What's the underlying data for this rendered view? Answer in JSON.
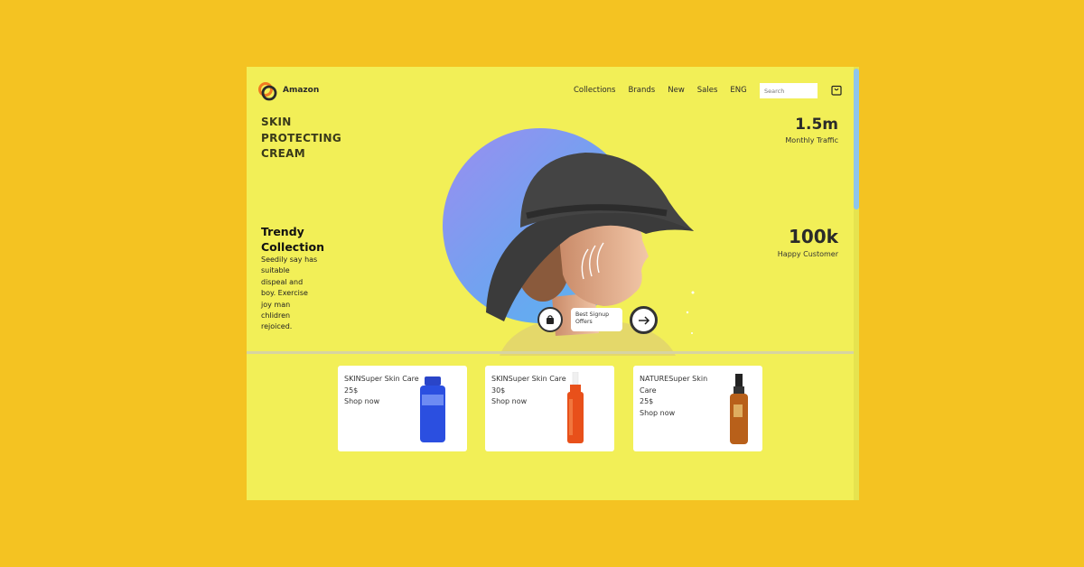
{
  "header": {
    "brand": "Amazon",
    "nav": [
      "Collections",
      "Brands",
      "New",
      "Sales",
      "ENG"
    ],
    "search_placeholder": "Search"
  },
  "hero": {
    "title_lines": [
      "SKIN",
      "PROTECTING",
      "CREAM"
    ],
    "trendy_title_lines": [
      "Trendy",
      "Collection"
    ],
    "trendy_desc_lines": [
      "Seedily say has",
      "suitable",
      "dispeal and",
      "boy. Exercise",
      "joy man",
      "chlidren",
      "rejoiced."
    ],
    "signup_lines": [
      "Best Signup",
      "Offers"
    ]
  },
  "stats": [
    {
      "value": "1.5m",
      "label": "Monthly Traffic"
    },
    {
      "value": "100k",
      "label": "Happy Customer"
    }
  ],
  "products": [
    {
      "name": "SKINSuper Skin Care",
      "price": "25$",
      "cta": "Shop now",
      "bottle_color": "#2b4fe0"
    },
    {
      "name": "SKINSuper Skin Care",
      "price": "30$",
      "cta": "Shop now",
      "bottle_color": "#e8501a"
    },
    {
      "name_lines": [
        "NATURESuper Skin",
        "Care"
      ],
      "price": "25$",
      "cta": "Shop now",
      "bottle_color": "#b8601a"
    }
  ],
  "colors": {
    "page_bg": "#f4c322",
    "frame_bg": "#f2ef57",
    "accent_blue": "#6aa6f0",
    "scrollbar": "#8ec5ea"
  },
  "icons": [
    "logo-icon",
    "cart-icon",
    "shopping-bag-icon",
    "arrow-right-icon"
  ]
}
